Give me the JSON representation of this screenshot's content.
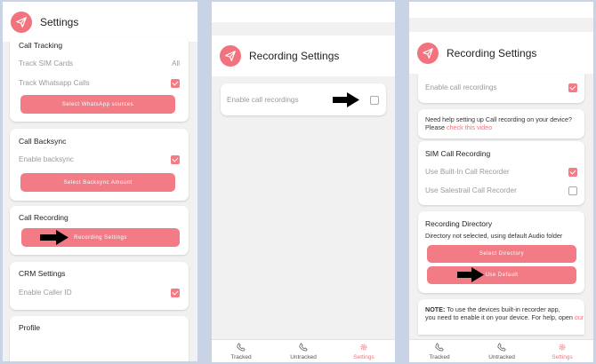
{
  "colors": {
    "accent": "#f37b85",
    "background": "#c9d3e6"
  },
  "panel1": {
    "title": "Settings",
    "call_tracking": {
      "title": "Call Tracking",
      "track_sim_label": "Track SIM Cards",
      "track_sim_value": "All",
      "track_whatsapp_label": "Track Whatsapp Calls",
      "whatsapp_button": "Select WhatsApp sources"
    },
    "call_backsync": {
      "title": "Call Backsync",
      "enable_label": "Enable backsync",
      "amount_button": "Select Backsync Amount"
    },
    "call_recording": {
      "title": "Call Recording",
      "settings_button": "Recording Settings"
    },
    "crm": {
      "title": "CRM Settings",
      "caller_id_label": "Enable Caller ID"
    },
    "profile": {
      "title": "Profile"
    }
  },
  "panel2": {
    "title": "Recording Settings",
    "enable_label": "Enable call recordings"
  },
  "panel3": {
    "title": "Recording Settings",
    "enable_label": "Enable call recordings",
    "help": {
      "line1": "Need help setting up Call recording on your device?",
      "line2_prefix": "Please ",
      "link": "check this video"
    },
    "sim": {
      "title": "SIM Call Recording",
      "builtin_label": "Use Built-In Call Recorder",
      "salestrail_label": "Use Salestrail Call Recorder"
    },
    "directory": {
      "title": "Recording Directory",
      "status": "Directory not selected, using default Audio folder",
      "select_button": "Select Directory",
      "default_button": "Use Default"
    },
    "note": {
      "label": "NOTE:",
      "line1": " To use the devices built-in recorder app,",
      "line2": "you need to enable it on your device. For help, open",
      "link": "our"
    }
  },
  "nav": {
    "tracked": "Tracked",
    "untracked": "Untracked",
    "settings": "Settings"
  }
}
